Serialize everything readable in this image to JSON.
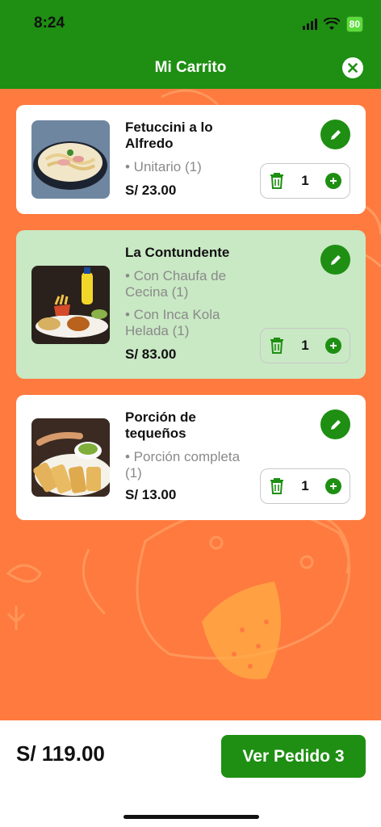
{
  "status": {
    "time": "8:24",
    "battery": "80"
  },
  "header": {
    "title": "Mi Carrito"
  },
  "items": [
    {
      "name": "Fetuccini a lo Alfredo",
      "options": [
        "• Unitario (1)"
      ],
      "price": "S/ 23.00",
      "qty": "1"
    },
    {
      "name": "La Contundente",
      "options": [
        "• Con Chaufa de Cecina (1)",
        "• Con Inca Kola Helada (1)"
      ],
      "price": "S/ 83.00",
      "qty": "1"
    },
    {
      "name": "Porción de tequeños",
      "options": [
        "• Porción completa (1)"
      ],
      "price": "S/ 13.00",
      "qty": "1"
    }
  ],
  "footer": {
    "total": "S/ 119.00",
    "order_button": "Ver Pedido 3"
  },
  "colors": {
    "accent": "#1e8f12",
    "background": "#ff7a3f",
    "highlight": "#c9e8c4"
  }
}
